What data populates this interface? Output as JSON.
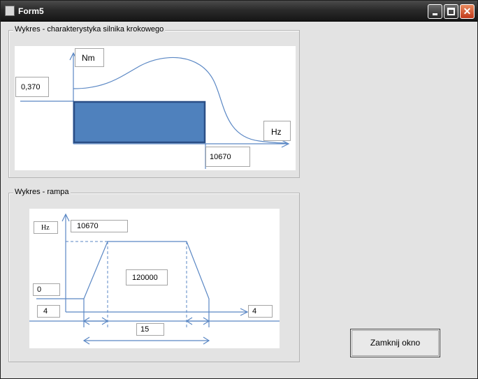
{
  "window": {
    "title": "Form5"
  },
  "group1": {
    "label": "Wykres - charakterystyka silnika krokowego",
    "unit_y": "Nm",
    "unit_x": "Hz",
    "torque_value": "0,370",
    "freq_value": "10670"
  },
  "group2": {
    "label": "Wykres - rampa",
    "unit_y": "Hz",
    "freq_max": "10670",
    "freq_start": "0",
    "ramp_left": "4",
    "ramp_right": "4",
    "steps": "120000",
    "duration": "15"
  },
  "buttons": {
    "close_label": "Zamknij okno"
  },
  "colors": {
    "plot_line": "#5a87c4",
    "rect_fill": "#4f81bd",
    "rect_border": "#2b4f86"
  }
}
